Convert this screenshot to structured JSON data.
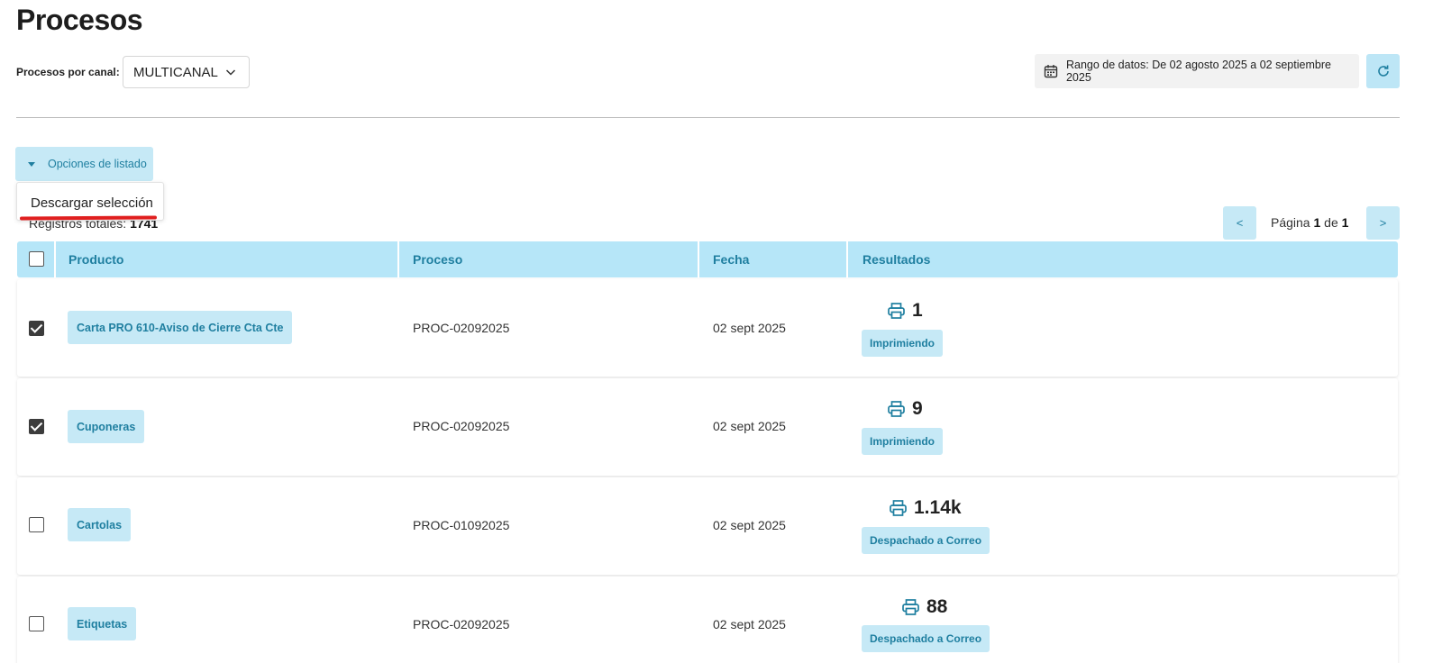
{
  "page": {
    "title": "Procesos"
  },
  "filters": {
    "channel_label": "Procesos por canal:",
    "channel_value": "MULTICANAL",
    "date_range_text": "Rango de datos: De 02 agosto 2025 a 02 septiembre 2025"
  },
  "list_options": {
    "button_label": "Opciones de listado",
    "menu_item": "Descargar selección"
  },
  "records": {
    "label": "Registros totales:",
    "count": "1741"
  },
  "pagination": {
    "prev": "<",
    "next": ">",
    "page_word": "Página",
    "current": "1",
    "of_word": "de",
    "total": "1"
  },
  "table": {
    "headers": {
      "producto": "Producto",
      "proceso": "Proceso",
      "fecha": "Fecha",
      "resultados": "Resultados"
    },
    "rows": [
      {
        "checked": true,
        "producto": "Carta PRO 610-Aviso de Cierre Cta Cte",
        "proceso": "PROC-02092025",
        "fecha": "02 sept 2025",
        "count": "1",
        "status": "Imprimiendo"
      },
      {
        "checked": true,
        "producto": "Cuponeras",
        "proceso": "PROC-02092025",
        "fecha": "02 sept 2025",
        "count": "9",
        "status": "Imprimiendo"
      },
      {
        "checked": false,
        "producto": "Cartolas",
        "proceso": "PROC-01092025",
        "fecha": "02 sept 2025",
        "count": "1.14k",
        "status": "Despachado a Correo"
      },
      {
        "checked": false,
        "producto": "Etiquetas",
        "proceso": "PROC-02092025",
        "fecha": "02 sept 2025",
        "count": "88",
        "status": "Despachado a Correo"
      }
    ]
  },
  "colors": {
    "accent": "#1f7fa0",
    "chip_bg": "#c6e9f6",
    "header_bg": "#b6e6f8",
    "annotation": "#e01f1f"
  },
  "icons": [
    "chevron-down-icon",
    "calendar-icon",
    "refresh-icon",
    "caret-down-icon",
    "printer-icon"
  ]
}
